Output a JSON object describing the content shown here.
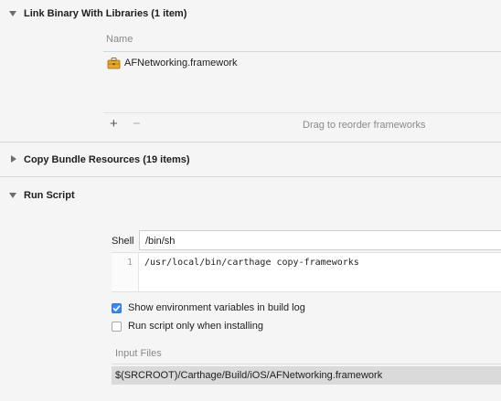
{
  "link_section": {
    "title": "Link Binary With Libraries (1 item)",
    "column_header": "Name",
    "items": [
      {
        "name": "AFNetworking.framework",
        "icon": "toolbox-icon"
      }
    ],
    "add_label": "+",
    "remove_label": "−",
    "drag_hint": "Drag to reorder frameworks"
  },
  "copy_section": {
    "title": "Copy Bundle Resources (19 items)"
  },
  "run_script": {
    "title": "Run Script",
    "shell_label": "Shell",
    "shell_value": "/bin/sh",
    "line_number": "1",
    "script_text": "/usr/local/bin/carthage copy-frameworks",
    "env_vars_label": "Show environment variables in build log",
    "env_vars_checked": true,
    "install_only_label": "Run script only when installing",
    "install_only_checked": false,
    "input_files_label": "Input Files",
    "input_files": [
      "$(SRCROOT)/Carthage/Build/iOS/AFNetworking.framework"
    ]
  },
  "colors": {
    "checkbox_accent": "#3d88ee",
    "selected_row": "#dadada",
    "panel_bg": "#f5f5f5",
    "field_bg": "#ffffff"
  }
}
